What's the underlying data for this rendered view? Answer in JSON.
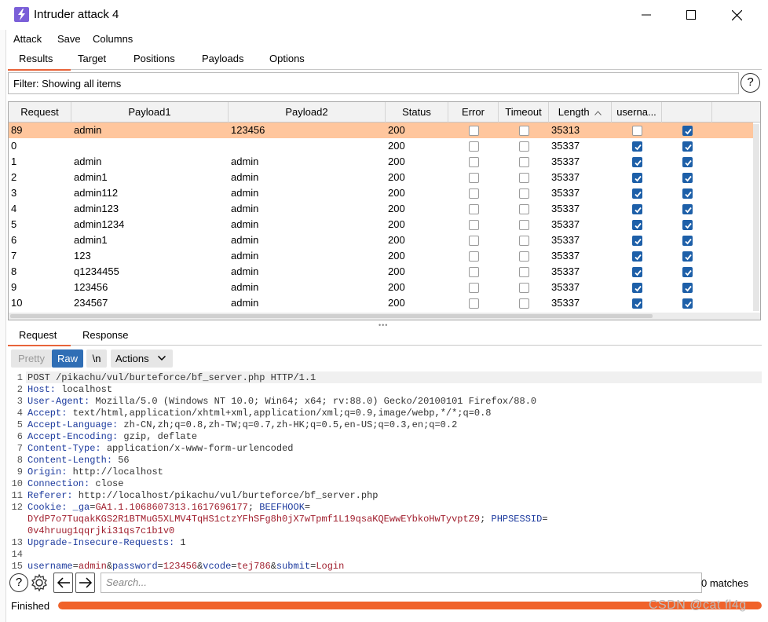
{
  "window": {
    "title": "Intruder attack 4",
    "app_icon": "burp-lightning-icon",
    "accent": "#7a5fd8"
  },
  "menu": [
    "Attack",
    "Save",
    "Columns"
  ],
  "tabs": {
    "items": [
      "Results",
      "Target",
      "Positions",
      "Payloads",
      "Options"
    ],
    "active": "Results"
  },
  "filter": {
    "label": "Filter: Showing all items"
  },
  "help_label": "?",
  "table": {
    "columns": [
      "Request",
      "Payload1",
      "Payload2",
      "Status",
      "Error",
      "Timeout",
      "Length",
      "userna...",
      ""
    ],
    "sort_column": "Length",
    "rows": [
      {
        "request": "89",
        "payload1": "admin",
        "payload2": "123456",
        "status": "200",
        "error": false,
        "timeout": false,
        "length": "35313",
        "userna": false,
        "extra": true,
        "selected": true
      },
      {
        "request": "0",
        "payload1": "",
        "payload2": "",
        "status": "200",
        "error": false,
        "timeout": false,
        "length": "35337",
        "userna": true,
        "extra": true,
        "selected": false
      },
      {
        "request": "1",
        "payload1": "admin",
        "payload2": "admin",
        "status": "200",
        "error": false,
        "timeout": false,
        "length": "35337",
        "userna": true,
        "extra": true,
        "selected": false
      },
      {
        "request": "2",
        "payload1": "admin1",
        "payload2": "admin",
        "status": "200",
        "error": false,
        "timeout": false,
        "length": "35337",
        "userna": true,
        "extra": true,
        "selected": false
      },
      {
        "request": "3",
        "payload1": "admin112",
        "payload2": "admin",
        "status": "200",
        "error": false,
        "timeout": false,
        "length": "35337",
        "userna": true,
        "extra": true,
        "selected": false
      },
      {
        "request": "4",
        "payload1": "admin123",
        "payload2": "admin",
        "status": "200",
        "error": false,
        "timeout": false,
        "length": "35337",
        "userna": true,
        "extra": true,
        "selected": false
      },
      {
        "request": "5",
        "payload1": "admin1234",
        "payload2": "admin",
        "status": "200",
        "error": false,
        "timeout": false,
        "length": "35337",
        "userna": true,
        "extra": true,
        "selected": false
      },
      {
        "request": "6",
        "payload1": "admin1",
        "payload2": "admin",
        "status": "200",
        "error": false,
        "timeout": false,
        "length": "35337",
        "userna": true,
        "extra": true,
        "selected": false
      },
      {
        "request": "7",
        "payload1": "123",
        "payload2": "admin",
        "status": "200",
        "error": false,
        "timeout": false,
        "length": "35337",
        "userna": true,
        "extra": true,
        "selected": false
      },
      {
        "request": "8",
        "payload1": "q1234455",
        "payload2": "admin",
        "status": "200",
        "error": false,
        "timeout": false,
        "length": "35337",
        "userna": true,
        "extra": true,
        "selected": false
      },
      {
        "request": "9",
        "payload1": "123456",
        "payload2": "admin",
        "status": "200",
        "error": false,
        "timeout": false,
        "length": "35337",
        "userna": true,
        "extra": true,
        "selected": false
      },
      {
        "request": "10",
        "payload1": "234567",
        "payload2": "admin",
        "status": "200",
        "error": false,
        "timeout": false,
        "length": "35337",
        "userna": true,
        "extra": true,
        "selected": false
      }
    ],
    "selected_color": "#ffc69d",
    "checkbox_color": "#1d5fa8"
  },
  "req_tabs": {
    "items": [
      "Request",
      "Response"
    ],
    "active": "Request"
  },
  "editor_toolbar": {
    "pretty": "Pretty",
    "raw": "Raw",
    "newline": "\\n",
    "actions": "Actions"
  },
  "request_lines": [
    {
      "n": "1",
      "key": "",
      "val": "POST /pikachu/vul/burteforce/bf_server.php HTTP/1.1"
    },
    {
      "n": "2",
      "key": "Host:",
      "val": " localhost"
    },
    {
      "n": "3",
      "key": "User-Agent:",
      "val": " Mozilla/5.0 (Windows NT 10.0; Win64; x64; rv:88.0) Gecko/20100101 Firefox/88.0"
    },
    {
      "n": "4",
      "key": "Accept:",
      "val": " text/html,application/xhtml+xml,application/xml;q=0.9,image/webp,*/*;q=0.8"
    },
    {
      "n": "5",
      "key": "Accept-Language:",
      "val": " zh-CN,zh;q=0.8,zh-TW;q=0.7,zh-HK;q=0.5,en-US;q=0.3,en;q=0.2"
    },
    {
      "n": "6",
      "key": "Accept-Encoding:",
      "val": " gzip, deflate"
    },
    {
      "n": "7",
      "key": "Content-Type:",
      "val": " application/x-www-form-urlencoded"
    },
    {
      "n": "8",
      "key": "Content-Length:",
      "val": " 56"
    },
    {
      "n": "9",
      "key": "Origin:",
      "val": " http://localhost"
    },
    {
      "n": "10",
      "key": "Connection:",
      "val": " close"
    },
    {
      "n": "11",
      "key": "Referer:",
      "val": " http://localhost/pikachu/vul/burteforce/bf_server.php"
    },
    {
      "n": "12",
      "key": "Cookie:",
      "val": ""
    },
    {
      "n": "13",
      "key": "Upgrade-Insecure-Requests:",
      "val": " 1"
    },
    {
      "n": "14",
      "key": "",
      "val": ""
    },
    {
      "n": "15",
      "key": "",
      "val": ""
    }
  ],
  "cookie": {
    "ga_name": " _ga",
    "ga_value": "GA1.1.1068607313.1617696177",
    "beef_name": " BEEFHOOK",
    "beef_value": "DYdP7o7TuqakKGS2R1BTMuG5XLMV4TqHS1ctzYFhSFg8h0jX7wTpmf1L19qsaKQEwwEYbkoHwTyvptZ9",
    "sess_name": " PHPSESSID",
    "sess_value": "0v4hruug1qqrjki31qs7c1b1v0"
  },
  "body_params": [
    {
      "name": "username",
      "value": "admin"
    },
    {
      "name": "password",
      "value": "123456"
    },
    {
      "name": "vcode",
      "value": "tej786"
    },
    {
      "name": "submit",
      "value": "Login"
    }
  ],
  "search": {
    "placeholder": "Search...",
    "matches": "0 matches"
  },
  "status": {
    "text": "Finished",
    "progress": 1.0,
    "progress_color": "#f0622a"
  },
  "watermark": "CSDN @cat fl4g"
}
